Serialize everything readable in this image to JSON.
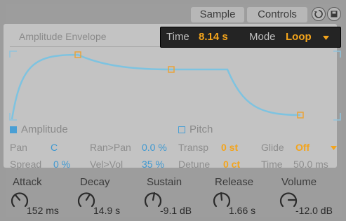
{
  "tabs": {
    "sample": "Sample",
    "controls": "Controls"
  },
  "envelope": {
    "title": "Amplitude Envelope",
    "popup": {
      "time_label": "Time",
      "time_value": "8.14 s",
      "mode_label": "Mode",
      "mode_value": "Loop"
    },
    "amplitude_label": "Amplitude",
    "pitch_label": "Pitch",
    "amplitude_checked": true,
    "pitch_checked": false
  },
  "params": {
    "pan": {
      "label": "Pan",
      "value": "C"
    },
    "ran_pan": {
      "label": "Ran>Pan",
      "value": "0.0 %"
    },
    "transp": {
      "label": "Transp",
      "value": "0 st"
    },
    "glide": {
      "label": "Glide",
      "value": "Off"
    },
    "spread": {
      "label": "Spread",
      "value": "0 %"
    },
    "vel_vol": {
      "label": "Vel>Vol",
      "value": "35 %"
    },
    "detune": {
      "label": "Detune",
      "value": "0 ct"
    },
    "time": {
      "label": "Time",
      "value": "50.0 ms"
    }
  },
  "knobs": [
    {
      "label": "Attack",
      "value": "152 ms"
    },
    {
      "label": "Decay",
      "value": "14.9 s"
    },
    {
      "label": "Sustain",
      "value": "-9.1 dB"
    },
    {
      "label": "Release",
      "value": "1.66 s"
    },
    {
      "label": "Volume",
      "value": "-12.0 dB"
    }
  ],
  "icons": {
    "reset": "rotate-icon",
    "save": "save-icon",
    "dropdown": "triangle-down-icon"
  },
  "colors": {
    "accent_orange": "#f3a41c",
    "accent_blue": "#3d98d1",
    "curve": "#7ec3e0"
  }
}
